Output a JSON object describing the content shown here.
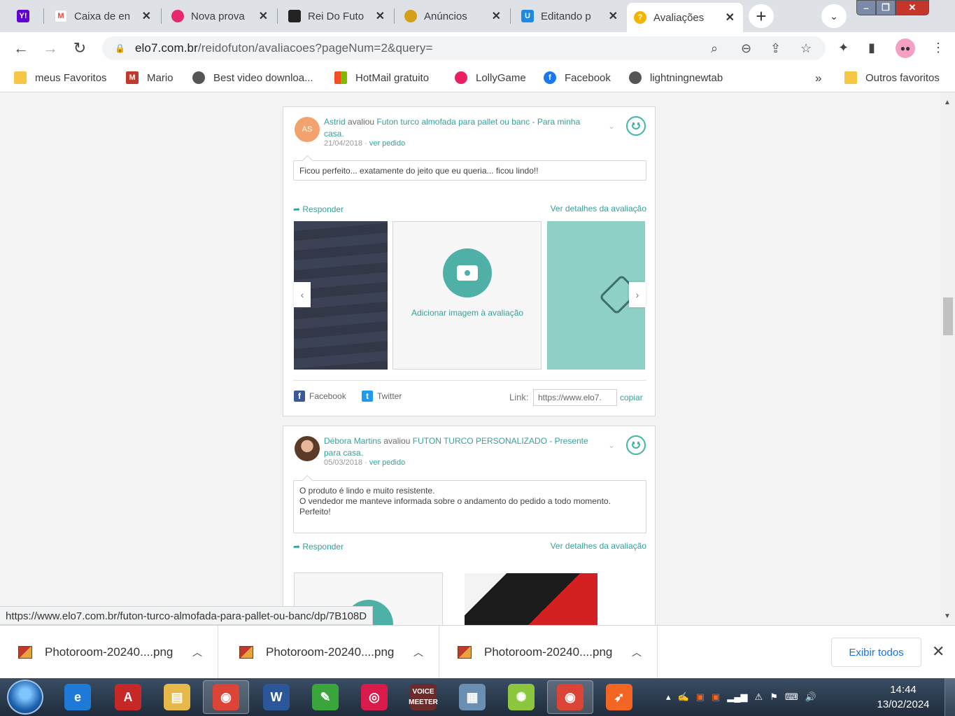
{
  "browser": {
    "tabs": [
      {
        "title": "",
        "favicon": "yahoo-icon",
        "color": "#5f01d1"
      },
      {
        "title": "Caixa de en",
        "favicon": "gmail-icon",
        "color": "#ea4335"
      },
      {
        "title": "Nova prova",
        "favicon": "flower-icon",
        "color": "#e6286e"
      },
      {
        "title": "Rei Do Futo",
        "favicon": "store-icon",
        "color": "#222222"
      },
      {
        "title": "Anúncios",
        "favicon": "ads-icon",
        "color": "#d4a017"
      },
      {
        "title": "Editando p",
        "favicon": "editor-icon",
        "color": "#1e88e5"
      },
      {
        "title": "Avaliações",
        "favicon": "elo7-icon",
        "color": "#f4b400"
      }
    ],
    "url_host": "elo7.com.br",
    "url_path": "/reidofuton/avaliacoes?pageNum=2&query=",
    "bookmarks": [
      {
        "label": "meus Favoritos",
        "icon": "folder-icon"
      },
      {
        "label": "Mario",
        "icon": "mario-icon"
      },
      {
        "label": "Best video downloa...",
        "icon": "globe-icon"
      },
      {
        "label": "HotMail gratuito",
        "icon": "windows-icon"
      },
      {
        "label": "LollyGame",
        "icon": "lolly-icon"
      },
      {
        "label": "Facebook",
        "icon": "facebook-icon"
      },
      {
        "label": "lightningnewtab",
        "icon": "globe-icon"
      }
    ],
    "overflow": "»",
    "other_bookmarks": "Outros favoritos"
  },
  "reviews": [
    {
      "initials": "AS",
      "reviewer": "Astrid",
      "verb": "avaliou",
      "product": "Futon turco almofada para pallet ou banc - Para minha casa.",
      "date": "21/04/2018",
      "order_link": "ver pedido",
      "text": "Ficou perfeito... exatamente do jeito que eu queria... ficou lindo!!",
      "reply": "Responder",
      "details": "Ver detalhes da avaliação",
      "add_image": "Adicionar imagem à avaliação",
      "share_facebook": "Facebook",
      "share_twitter": "Twitter",
      "link_label": "Link:",
      "link_value": "https://www.elo7.",
      "copy": "copiar"
    },
    {
      "reviewer": "Débora Martins",
      "verb": "avaliou",
      "product": "FUTON TURCO PERSONALIZADO - Presente para casa.",
      "date": "05/03/2018",
      "order_link": "ver pedido",
      "text_lines": [
        "O produto é lindo e muito resistente.",
        "O vendedor me manteve informada sobre o andamento do pedido a todo momento.",
        "Perfeito!"
      ],
      "reply": "Responder",
      "details": "Ver detalhes da avaliação"
    }
  ],
  "status_url": "https://www.elo7.com.br/futon-turco-almofada-para-pallet-ou-banc/dp/7B108D",
  "downloads": [
    {
      "name": "Photoroom-20240....png"
    },
    {
      "name": "Photoroom-20240....png"
    },
    {
      "name": "Photoroom-20240....png"
    }
  ],
  "show_all": "Exibir todos",
  "taskbar": {
    "apps": [
      {
        "name": "ie-icon",
        "color": "#1e7ad6",
        "glyph": "e"
      },
      {
        "name": "acrobat-icon",
        "color": "#c62828",
        "glyph": "A"
      },
      {
        "name": "explorer-icon",
        "color": "#e7b94a",
        "glyph": "▤"
      },
      {
        "name": "chrome-icon",
        "color": "#db4437",
        "glyph": "◉"
      },
      {
        "name": "word-icon",
        "color": "#2b579a",
        "glyph": "W"
      },
      {
        "name": "feather-icon",
        "color": "#3aa53a",
        "glyph": "✎"
      },
      {
        "name": "camera-app-icon",
        "color": "#d81b4a",
        "glyph": "◎"
      },
      {
        "name": "voicemeeter-icon",
        "color": "#6d2a2a",
        "glyph": ""
      },
      {
        "name": "photos-icon",
        "color": "#6b8fb3",
        "glyph": "▦"
      },
      {
        "name": "lime-icon",
        "color": "#8cc63f",
        "glyph": "✺"
      },
      {
        "name": "chrome-profile-icon",
        "color": "#db4437",
        "glyph": "◉"
      },
      {
        "name": "orange-app-icon",
        "color": "#f26522",
        "glyph": "➶"
      }
    ],
    "voicemeeter_top": "VOICE",
    "voicemeeter_bottom": "MEETER",
    "time": "14:44",
    "date": "13/02/2024"
  }
}
